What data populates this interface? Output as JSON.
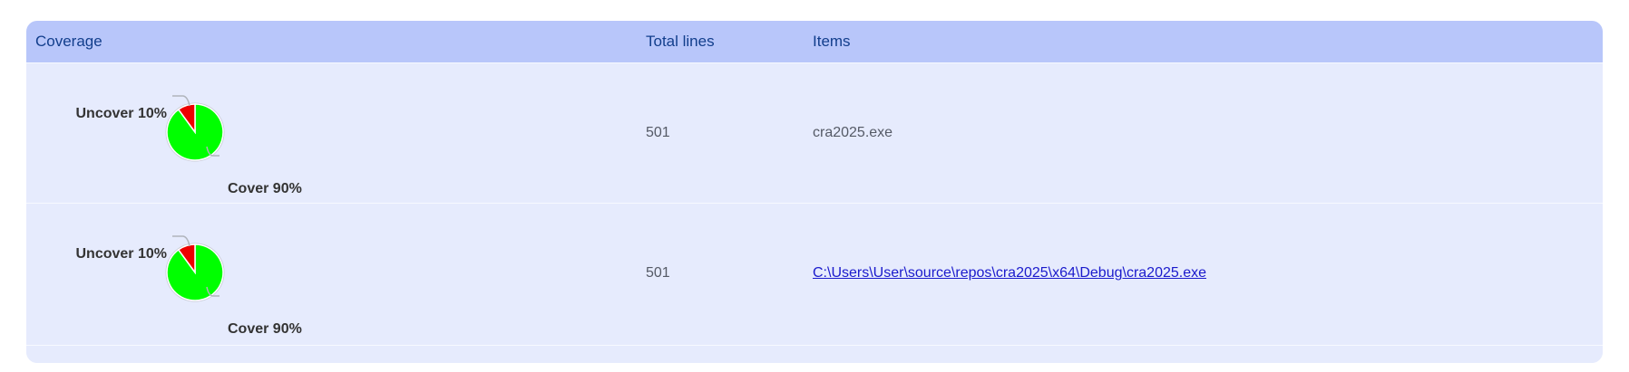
{
  "header": {
    "coverage": "Coverage",
    "total_lines": "Total lines",
    "items": "Items"
  },
  "rows": [
    {
      "uncover_label": "Uncover 10%",
      "cover_label": "Cover 90%",
      "uncover_percent": 10,
      "cover_percent": 90,
      "total_lines": "501",
      "item": "cra2025.exe",
      "item_is_link": false
    },
    {
      "uncover_label": "Uncover 10%",
      "cover_label": "Cover 90%",
      "uncover_percent": 10,
      "cover_percent": 90,
      "total_lines": "501",
      "item": "C:\\Users\\User\\source\\repos\\cra2025\\x64\\Debug\\cra2025.exe",
      "item_is_link": true
    }
  ],
  "colors": {
    "cover": "#00ff00",
    "uncover": "#ee0000"
  }
}
